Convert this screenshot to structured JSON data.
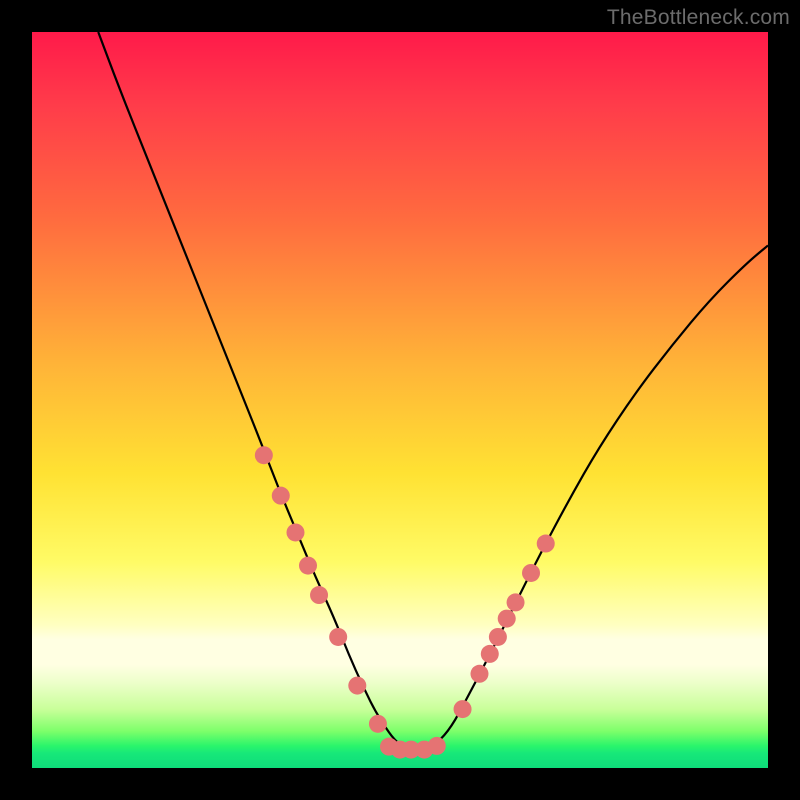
{
  "watermark": "TheBottleneck.com",
  "chart_data": {
    "type": "line",
    "title": "",
    "xlabel": "",
    "ylabel": "",
    "xlim": [
      0,
      100
    ],
    "ylim": [
      0,
      100
    ],
    "grid": false,
    "legend": false,
    "background_gradient": [
      "#ff1a4a",
      "#ff6a3f",
      "#ffe233",
      "#ffffe2",
      "#17e879"
    ],
    "series": [
      {
        "name": "curve",
        "type": "line",
        "color": "#000000",
        "x": [
          9,
          12,
          16,
          20,
          24,
          28,
          31,
          33.5,
          36,
          38.5,
          41,
          43,
          45,
          47,
          50,
          53,
          55,
          57,
          59,
          62,
          65.5,
          69,
          73,
          77,
          82,
          87,
          92,
          97,
          100
        ],
        "y": [
          100,
          92,
          82,
          72,
          62,
          52,
          44.5,
          38,
          32,
          26,
          20.5,
          15.5,
          11,
          7,
          2.7,
          2.5,
          3.3,
          5.6,
          9.3,
          15,
          22,
          29,
          36.5,
          43.5,
          51,
          57.5,
          63.5,
          68.5,
          71
        ]
      },
      {
        "name": "left-dots",
        "type": "scatter",
        "color": "#e57373",
        "radius": 9,
        "x": [
          31.5,
          33.8,
          35.8,
          37.5,
          39.0,
          41.6,
          44.2,
          47.0
        ],
        "y": [
          42.5,
          37.0,
          32.0,
          27.5,
          23.5,
          17.8,
          11.2,
          6.0
        ]
      },
      {
        "name": "bottom-dots",
        "type": "scatter",
        "color": "#e57373",
        "radius": 9,
        "x": [
          48.5,
          50.0,
          51.5,
          53.3,
          55.0
        ],
        "y": [
          2.9,
          2.5,
          2.5,
          2.5,
          3.0
        ]
      },
      {
        "name": "right-dots",
        "type": "scatter",
        "color": "#e57373",
        "radius": 9,
        "x": [
          58.5,
          60.8,
          62.2,
          63.3,
          64.5,
          65.7,
          67.8,
          69.8
        ],
        "y": [
          8.0,
          12.8,
          15.5,
          17.8,
          20.3,
          22.5,
          26.5,
          30.5
        ]
      }
    ]
  }
}
